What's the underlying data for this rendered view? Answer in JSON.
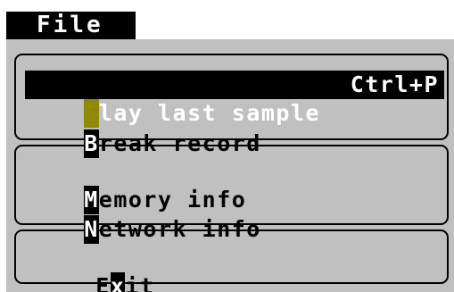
{
  "menubar": {
    "title": "File"
  },
  "menu": {
    "sections": [
      {
        "items": [
          {
            "hotkey": "P",
            "rest": "lay last sample",
            "shortcut": "Ctrl+P",
            "selected": true
          },
          {
            "hotkey": "B",
            "rest": "reak record",
            "shortcut": "",
            "selected": false
          }
        ]
      },
      {
        "items": [
          {
            "hotkey": "M",
            "rest": "emory info",
            "shortcut": "",
            "selected": false
          },
          {
            "hotkey": "N",
            "rest": "etwork info",
            "shortcut": "",
            "selected": false
          }
        ]
      },
      {
        "items": [
          {
            "prefix": "E",
            "hotkey": "x",
            "rest": "it",
            "shortcut": "",
            "selected": false
          }
        ]
      }
    ]
  },
  "colors": {
    "menu_background": "#c0c0c0",
    "selection_background": "#000000",
    "selection_text": "#ffffff",
    "selected_hotkey_marker": "#8f8a06",
    "text": "#000000"
  }
}
